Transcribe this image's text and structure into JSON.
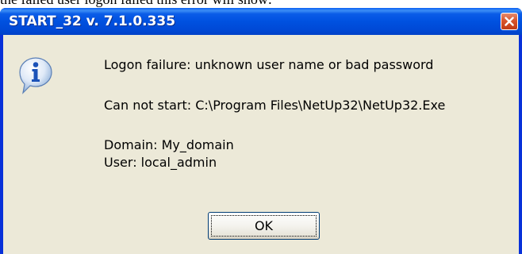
{
  "page": {
    "top_text": "the failed user logon failed this error will show:"
  },
  "window": {
    "title": "START_32 v. 7.1.0.335"
  },
  "dialog": {
    "icon": "info-icon",
    "lines": {
      "error": "Logon failure: unknown user name or bad password",
      "cannot_start": "Can not start: C:\\Program Files\\NetUp32\\NetUp32.Exe",
      "domain": "Domain: My_domain",
      "user": "User: local_admin"
    },
    "ok_label": "OK"
  },
  "colors": {
    "titlebar": "#0054e3",
    "client_bg": "#ece9d8",
    "close_button": "#d9542b"
  }
}
